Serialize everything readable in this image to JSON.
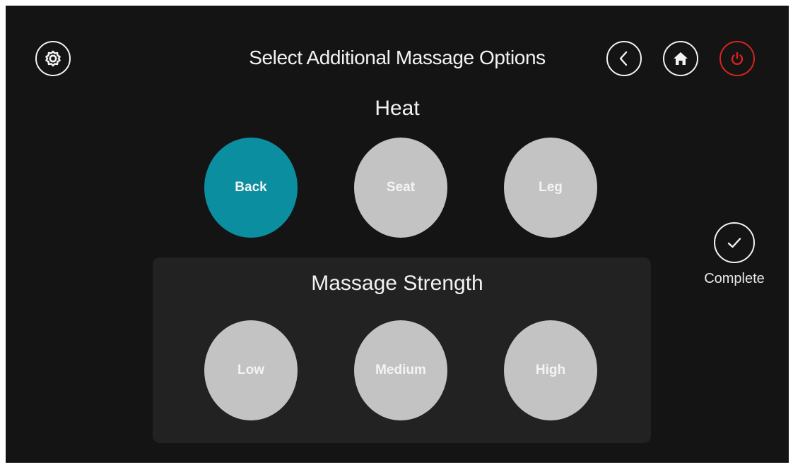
{
  "header": {
    "title": "Select Additional Massage Options",
    "settings_icon": "gear-icon",
    "back_icon": "chevron-left-icon",
    "home_icon": "home-icon",
    "power_icon": "power-icon"
  },
  "heat": {
    "title": "Heat",
    "options": [
      {
        "label": "Back",
        "selected": true
      },
      {
        "label": "Seat",
        "selected": false
      },
      {
        "label": "Leg",
        "selected": false
      }
    ]
  },
  "strength": {
    "title": "Massage Strength",
    "options": [
      {
        "label": "Low",
        "selected": false
      },
      {
        "label": "Medium",
        "selected": false
      },
      {
        "label": "High",
        "selected": false
      }
    ]
  },
  "complete": {
    "label": "Complete",
    "icon": "check-icon"
  },
  "colors": {
    "background": "#141414",
    "panel": "#222222",
    "active": "#0b8ea0",
    "inactive": "#c3c3c3",
    "power": "#d9231f"
  }
}
